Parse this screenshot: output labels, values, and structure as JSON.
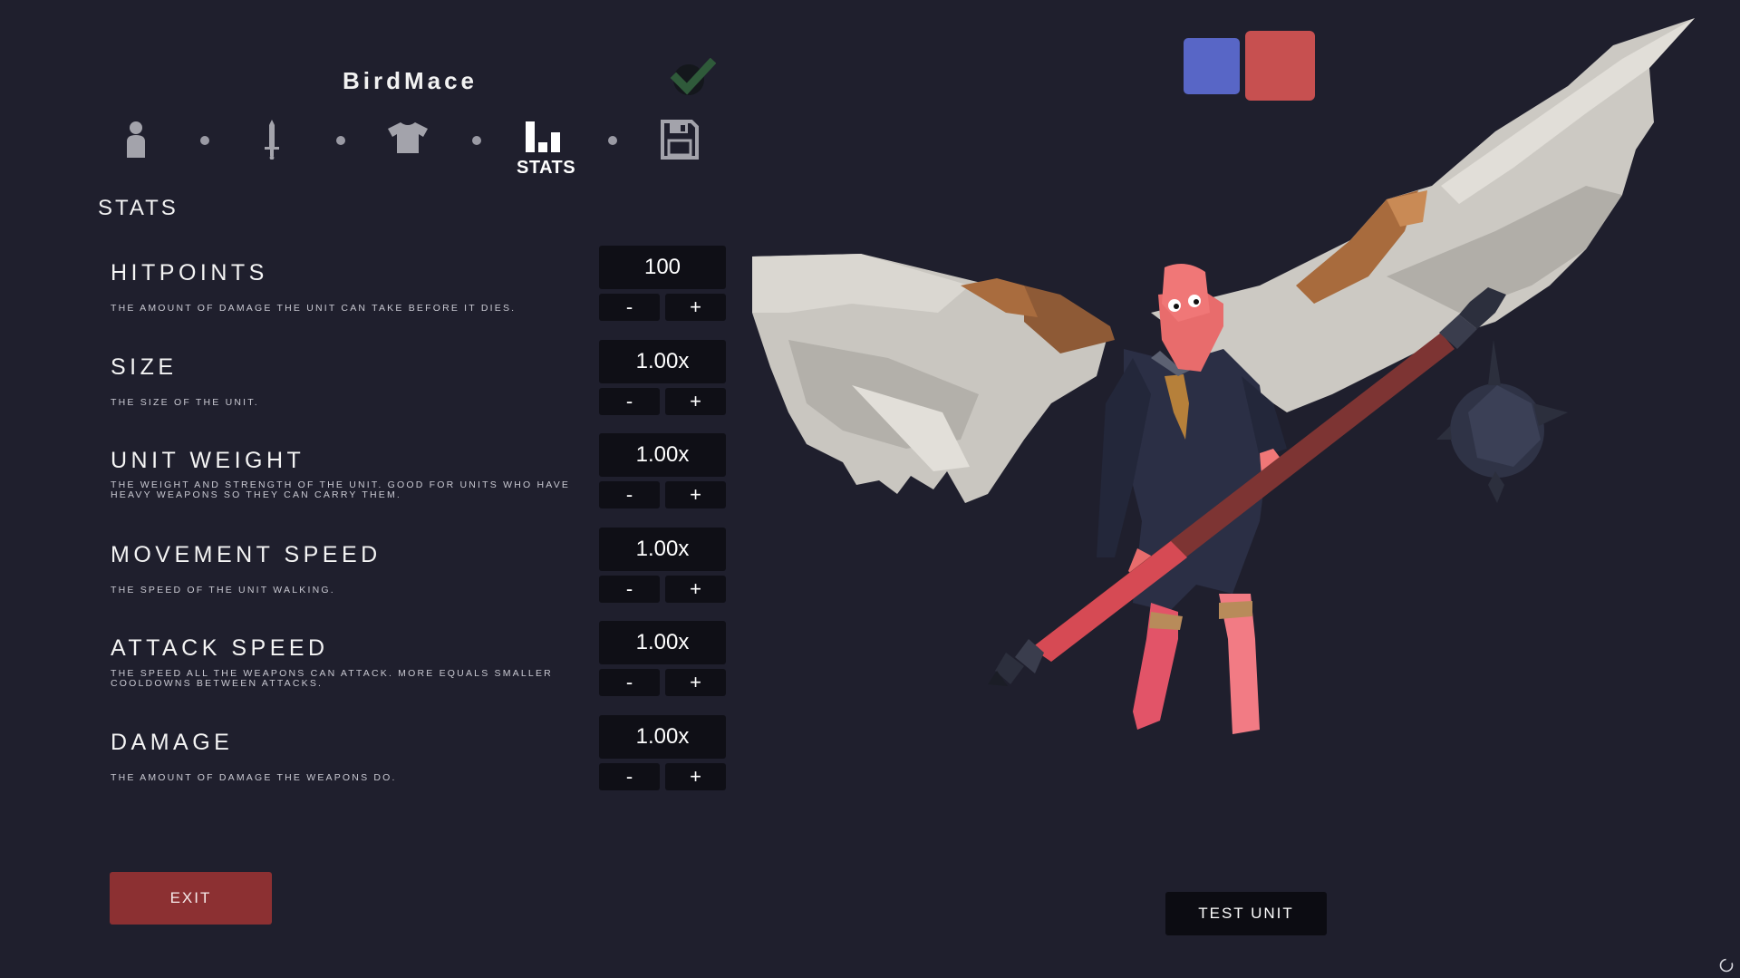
{
  "header": {
    "unit_name": "BirdMace",
    "icons": {
      "confirm": "check-icon"
    }
  },
  "steps": [
    {
      "icon": "person-icon",
      "label": "",
      "active": false
    },
    {
      "icon": "sword-icon",
      "label": "",
      "active": false
    },
    {
      "icon": "shirt-icon",
      "label": "",
      "active": false
    },
    {
      "icon": "bar-chart-icon",
      "label": "STATS",
      "active": true
    },
    {
      "icon": "save-icon",
      "label": "",
      "active": false
    }
  ],
  "section_title": "STATS",
  "stats": [
    {
      "name": "HITPOINTS",
      "description": "THE AMOUNT OF DAMAGE THE UNIT CAN TAKE BEFORE IT DIES.",
      "value": "100",
      "minus": "-",
      "plus": "+"
    },
    {
      "name": "SIZE",
      "description": "THE SIZE OF THE UNIT.",
      "value": "1.00x",
      "minus": "-",
      "plus": "+"
    },
    {
      "name": "UNIT WEIGHT",
      "description": "THE WEIGHT AND STRENGTH OF THE UNIT. GOOD FOR UNITS WHO HAVE HEAVY WEAPONS SO THEY CAN CARRY THEM.",
      "value": "1.00x",
      "minus": "-",
      "plus": "+"
    },
    {
      "name": "MOVEMENT SPEED",
      "description": "THE SPEED OF THE UNIT WALKING.",
      "value": "1.00x",
      "minus": "-",
      "plus": "+"
    },
    {
      "name": "ATTACK SPEED",
      "description": "THE SPEED ALL THE WEAPONS CAN ATTACK. MORE EQUALS SMALLER COOLDOWNS BETWEEN ATTACKS.",
      "value": "1.00x",
      "minus": "-",
      "plus": "+"
    },
    {
      "name": "DAMAGE",
      "description": "THE AMOUNT OF DAMAGE THE WEAPONS DO.",
      "value": "1.00x",
      "minus": "-",
      "plus": "+"
    }
  ],
  "buttons": {
    "exit": "EXIT",
    "test_unit": "TEST UNIT"
  },
  "teams": [
    {
      "name": "blue",
      "color": "#5866c6"
    },
    {
      "name": "red",
      "color": "#c75050"
    }
  ],
  "colors": {
    "background": "#1f1f2d",
    "field": "#0f0f16",
    "exit_button": "#8c3032",
    "check": "#2f5a3a"
  }
}
